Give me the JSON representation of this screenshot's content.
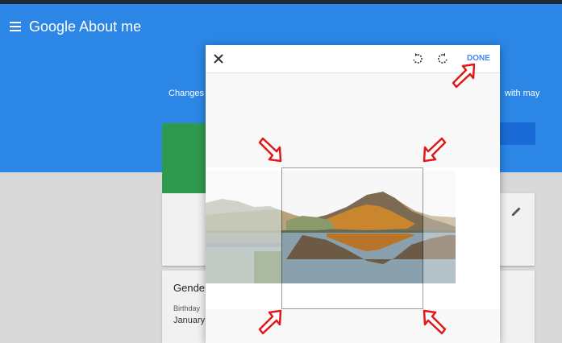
{
  "app": {
    "title": "Google About me",
    "menu_icon": "hamburger-menu-icon"
  },
  "band": {
    "text_left": "Changes y",
    "text_right": "with may"
  },
  "cards": {
    "gender_label": "Gender",
    "birthday_label": "Birthday",
    "birthday_value": "January",
    "edit_icon": "pencil-icon"
  },
  "dialog": {
    "close_icon": "close-icon",
    "rotate_left_icon": "rotate-left-icon",
    "rotate_right_icon": "rotate-right-icon",
    "done_label": "DONE"
  },
  "colors": {
    "header_blue": "#2b86e6",
    "done_blue": "#4285f4",
    "annotation_red": "#e01818",
    "green": "#2e9a4d"
  }
}
